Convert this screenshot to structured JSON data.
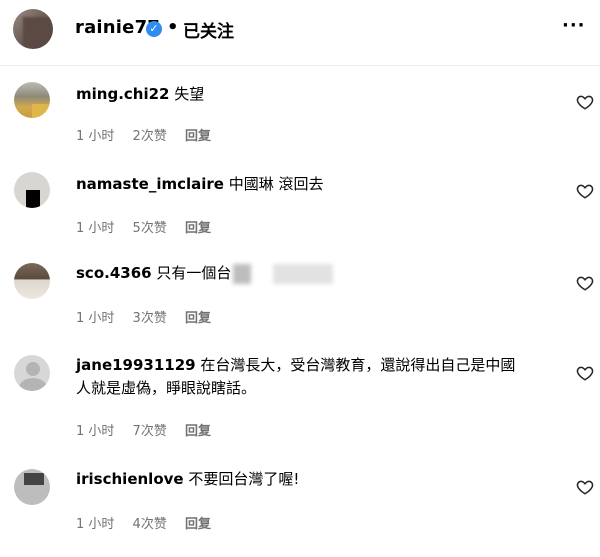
{
  "header": {
    "username": "rainie77",
    "verified_symbol": "✓",
    "separator": "•",
    "follow_status": "已关注",
    "more_label": "···"
  },
  "comments": [
    {
      "username": "ming.chi22",
      "text": "失望",
      "time": "1 小时",
      "likes": "2次赞",
      "reply": "回复"
    },
    {
      "username": "namaste_imclaire",
      "text": "中國琳 滾回去",
      "time": "1 小时",
      "likes": "5次赞",
      "reply": "回复"
    },
    {
      "username": "sco.4366",
      "text": "只有一個台",
      "time": "1 小时",
      "likes": "3次赞",
      "reply": "回复"
    },
    {
      "username": "jane19931129",
      "text": "在台灣長大，受台灣教育，還說得出自己是中國",
      "text2": "人就是虛偽，睜眼說瞎話。",
      "time": "1 小时",
      "likes": "7次赞",
      "reply": "回复"
    },
    {
      "username": "irischienlove",
      "text": "不要回台灣了喔!",
      "time": "1 小时",
      "likes": "4次赞",
      "reply": "回复"
    }
  ],
  "colors": {
    "verified": "#2f8cf0",
    "meta_text": "#737373",
    "divider": "#efefef"
  },
  "icons": {
    "like": "heart-outline-icon",
    "more": "more-horizontal-icon",
    "verified": "verified-badge-icon"
  }
}
